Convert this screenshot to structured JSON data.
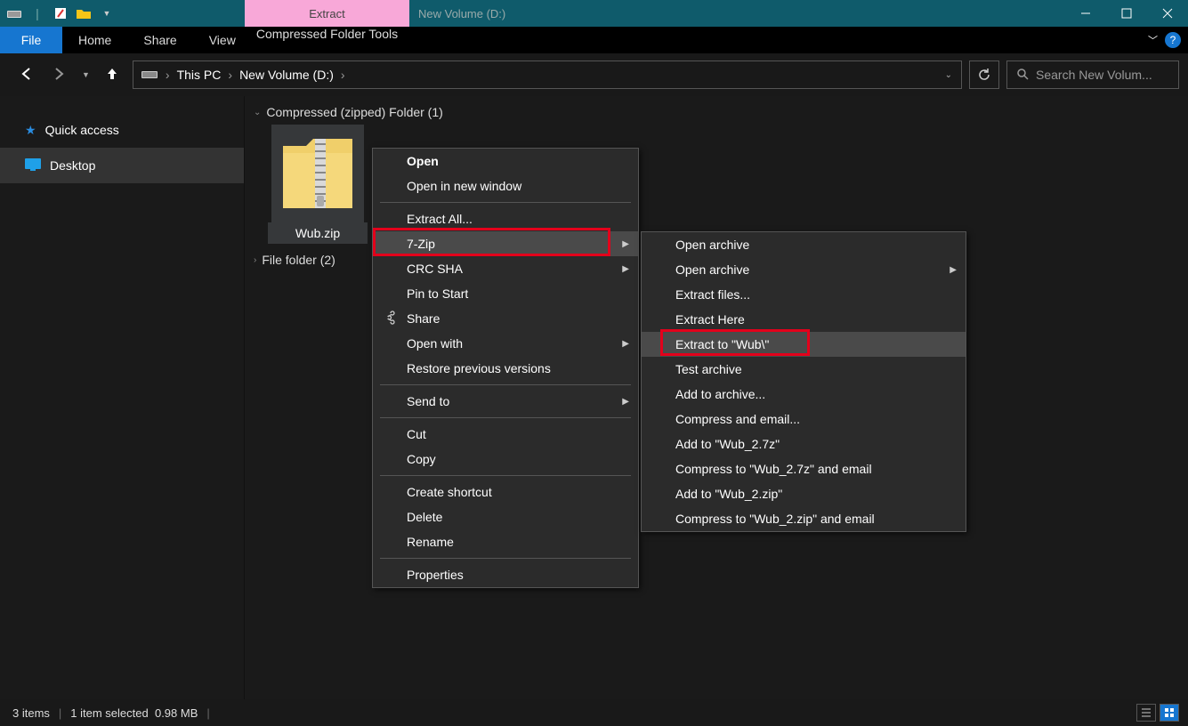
{
  "title": "New Volume (D:)",
  "ribbon": {
    "contextual_group": "Extract",
    "file": "File",
    "tabs": [
      "Home",
      "Share",
      "View"
    ],
    "contextual_tab": "Compressed Folder Tools"
  },
  "breadcrumb": {
    "root": "This PC",
    "current": "New Volume (D:)"
  },
  "search_placeholder": "Search New Volum...",
  "sidebar": {
    "quick_access": "Quick access",
    "desktop": "Desktop"
  },
  "groups": {
    "zip_header": "Compressed (zipped) Folder (1)",
    "folder_header": "File folder (2)"
  },
  "file": {
    "name": "Wub.zip"
  },
  "ctx1": {
    "open": "Open",
    "open_new": "Open in new window",
    "extract_all": "Extract All...",
    "seven_zip": "7-Zip",
    "crc": "CRC SHA",
    "pin": "Pin to Start",
    "share": "Share",
    "open_with": "Open with",
    "restore": "Restore previous versions",
    "send_to": "Send to",
    "cut": "Cut",
    "copy": "Copy",
    "shortcut": "Create shortcut",
    "delete": "Delete",
    "rename": "Rename",
    "properties": "Properties"
  },
  "ctx2": {
    "open_archive1": "Open archive",
    "open_archive2": "Open archive",
    "extract_files": "Extract files...",
    "extract_here": "Extract Here",
    "extract_to": "Extract to \"Wub\\\"",
    "test": "Test archive",
    "add_archive": "Add to archive...",
    "compress_email": "Compress and email...",
    "add_7z": "Add to \"Wub_2.7z\"",
    "compress_7z_email": "Compress to \"Wub_2.7z\" and email",
    "add_zip": "Add to \"Wub_2.zip\"",
    "compress_zip_email": "Compress to \"Wub_2.zip\" and email"
  },
  "status": {
    "items": "3 items",
    "selected": "1 item selected",
    "size": "0.98 MB"
  }
}
